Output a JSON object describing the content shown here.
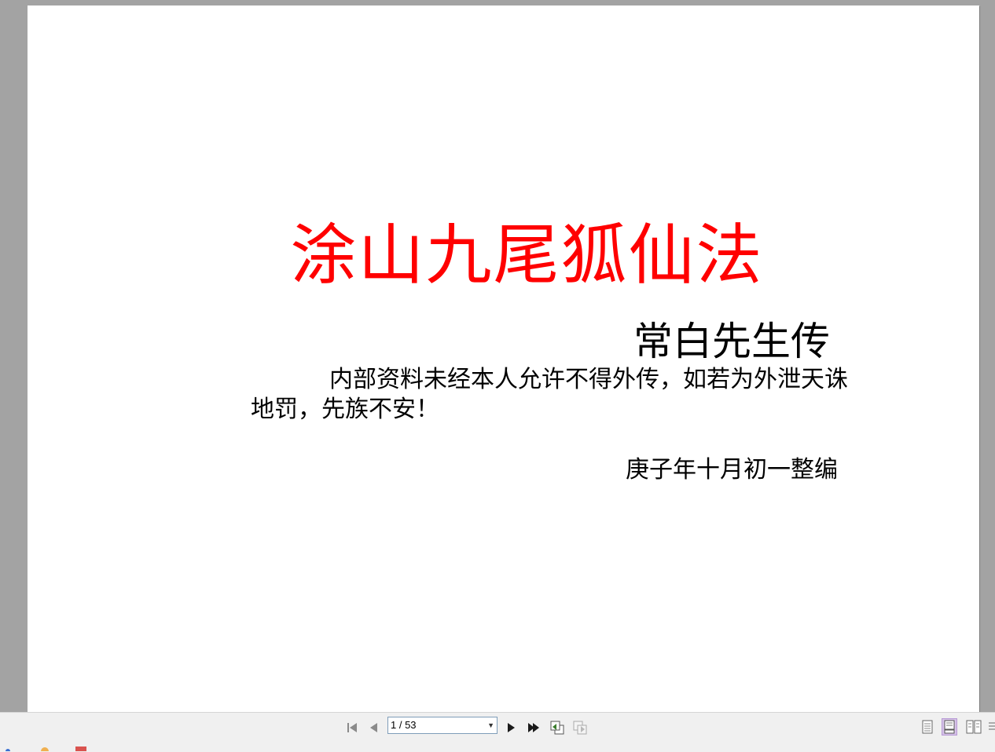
{
  "document": {
    "title": "涂山九尾狐仙法",
    "author": "常白先生传",
    "notice": "内部资料未经本人允许不得外传，如若为外泄天诛地罚，先族不安！",
    "date_line": "庚子年十月初一整编",
    "title_color": "#ff0000"
  },
  "toolbar": {
    "page_indicator": "1 / 53",
    "icons": {
      "first": "first-page-icon",
      "prev": "previous-page-icon",
      "next": "next-page-icon",
      "last": "last-page-icon",
      "back": "go-back-icon",
      "forward": "go-forward-icon",
      "single": "single-page-view-icon",
      "continuous": "continuous-view-icon",
      "facing": "facing-view-icon",
      "more": "more-view-icon"
    }
  }
}
